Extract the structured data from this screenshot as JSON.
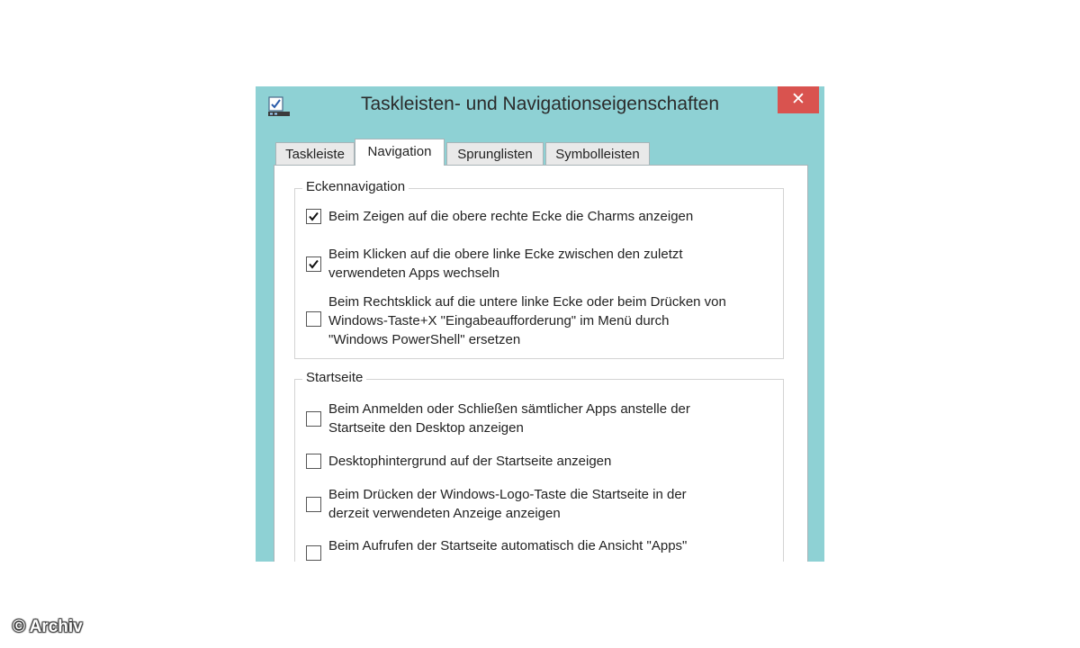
{
  "window": {
    "title": "Taskleisten- und Navigationseigenschaften",
    "close_glyph": "✕",
    "icon": "taskbar-properties-icon",
    "close_color": "#d9534f",
    "frame_color": "#8ed1d4"
  },
  "tabs": [
    {
      "label": "Taskleiste",
      "active": false
    },
    {
      "label": "Navigation",
      "active": true
    },
    {
      "label": "Sprunglisten",
      "active": false
    },
    {
      "label": "Symbolleisten",
      "active": false
    }
  ],
  "eckennavigation": {
    "label": "Eckennavigation",
    "options": [
      {
        "checked": true,
        "lines": [
          "Beim Zeigen auf die obere rechte Ecke die Charms anzeigen"
        ]
      },
      {
        "checked": true,
        "lines": [
          "Beim Klicken auf die obere linke Ecke zwischen den zuletzt",
          "verwendeten Apps wechseln"
        ]
      },
      {
        "checked": false,
        "lines": [
          "Beim Rechtsklick auf die untere linke Ecke oder beim Drücken von",
          "Windows-Taste+X \"Eingabeaufforderung\" im Menü durch",
          "\"Windows PowerShell\" ersetzen"
        ]
      }
    ]
  },
  "startseite": {
    "label": "Startseite",
    "options": [
      {
        "checked": false,
        "lines": [
          "Beim Anmelden oder Schließen sämtlicher Apps anstelle der",
          "Startseite den Desktop anzeigen"
        ]
      },
      {
        "checked": false,
        "lines": [
          "Desktophintergrund auf der Startseite anzeigen"
        ]
      },
      {
        "checked": false,
        "lines": [
          "Beim Drücken der Windows-Logo-Taste die Startseite in der",
          "derzeit verwendeten Anzeige anzeigen"
        ]
      },
      {
        "checked": false,
        "lines": [
          "Beim Aufrufen der Startseite automatisch die Ansicht \"Apps\""
        ]
      }
    ]
  },
  "watermark": "© Archiv"
}
